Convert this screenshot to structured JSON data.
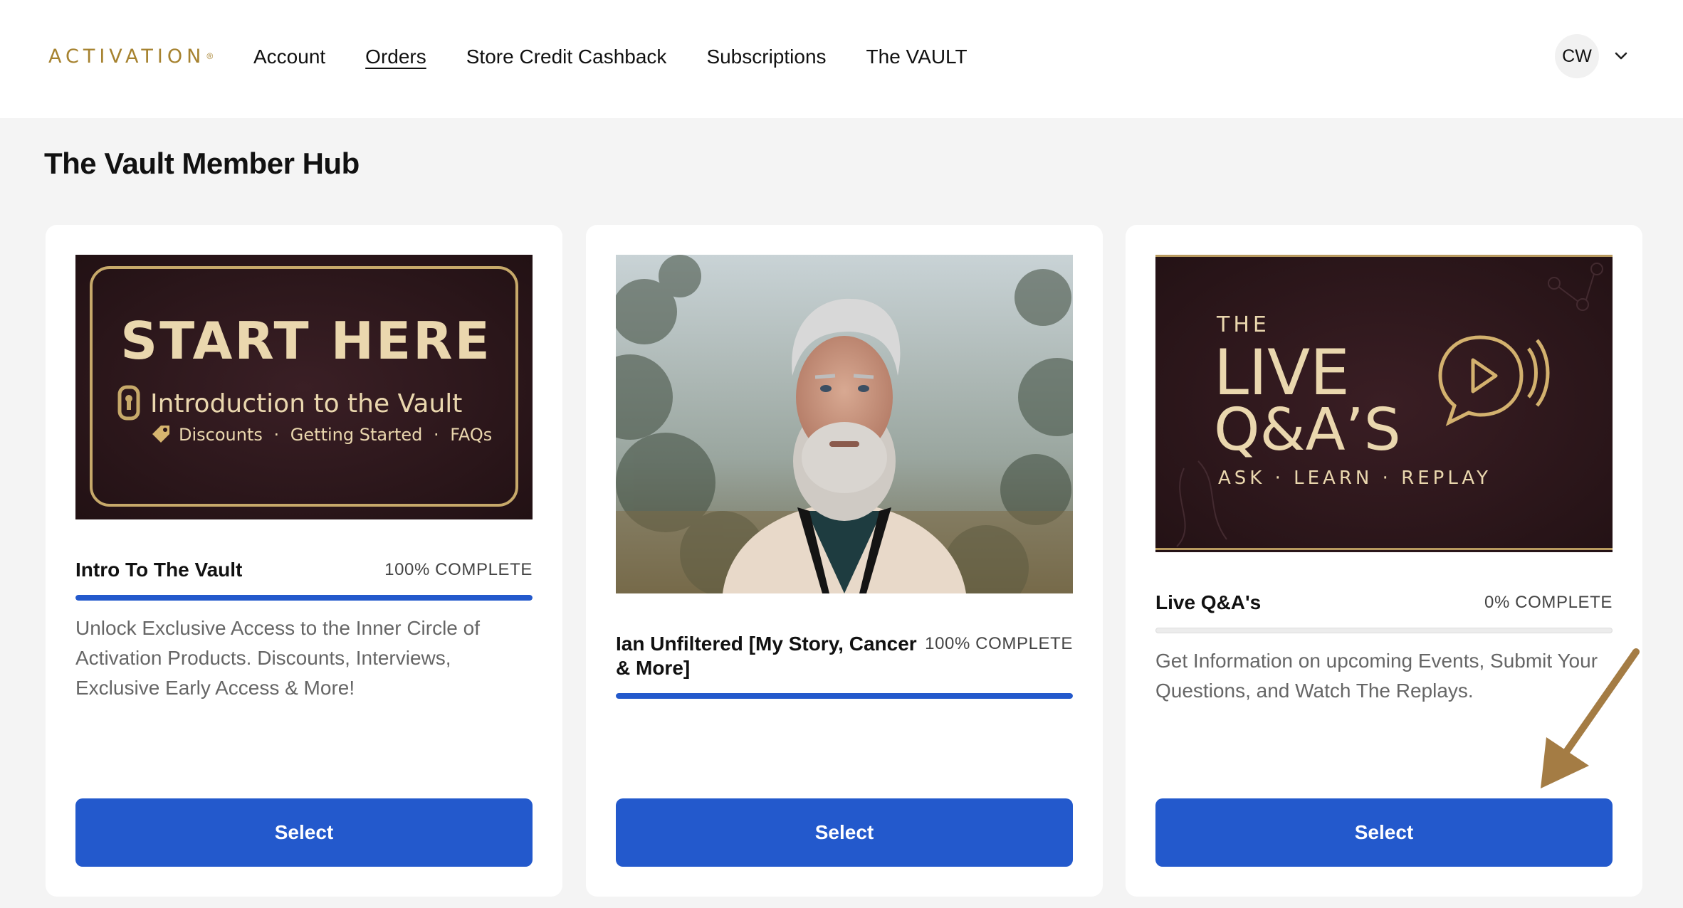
{
  "header": {
    "logo_text": "ACTIVATION",
    "logo_mark": "®",
    "nav": [
      {
        "label": "Account",
        "active": false
      },
      {
        "label": "Orders",
        "active": true
      },
      {
        "label": "Store Credit Cashback",
        "active": false
      },
      {
        "label": "Subscriptions",
        "active": false
      },
      {
        "label": "The VAULT",
        "active": false
      }
    ],
    "avatar_initials": "CW"
  },
  "page": {
    "title": "The Vault Member Hub"
  },
  "cards": [
    {
      "image": {
        "heading": "START HERE",
        "subheading": "Introduction to the Vault",
        "tags": [
          "Discounts",
          "·",
          "Getting Started",
          "·",
          "FAQs"
        ]
      },
      "title": "Intro To The Vault",
      "progress_label": "100% COMPLETE",
      "progress": 1.0,
      "description": "Unlock Exclusive Access to the Inner Circle of Activation Products. Discounts, Interviews, Exclusive Early Access & More!",
      "button": "Select"
    },
    {
      "image": {},
      "title": "Ian Unfiltered [My Story, Cancer & More]",
      "progress_label": "100% COMPLETE",
      "progress": 1.0,
      "description": "",
      "button": "Select"
    },
    {
      "image": {
        "line1": "THE",
        "line2": "LIVE",
        "line3": "Q&A’S",
        "tagline": "ASK · LEARN · REPLAY"
      },
      "title": "Live Q&A's",
      "progress_label": "0% COMPLETE",
      "progress": 0.0,
      "description": "Get Information on upcoming Events, Submit Your Questions, and Watch The Replays.",
      "button": "Select"
    }
  ],
  "colors": {
    "accent": "#2359cc",
    "gold": "#d7b97a",
    "brand_gold": "#a6822f",
    "dark_panel": "#2a161a",
    "annotation_arrow": "#a47c44"
  }
}
